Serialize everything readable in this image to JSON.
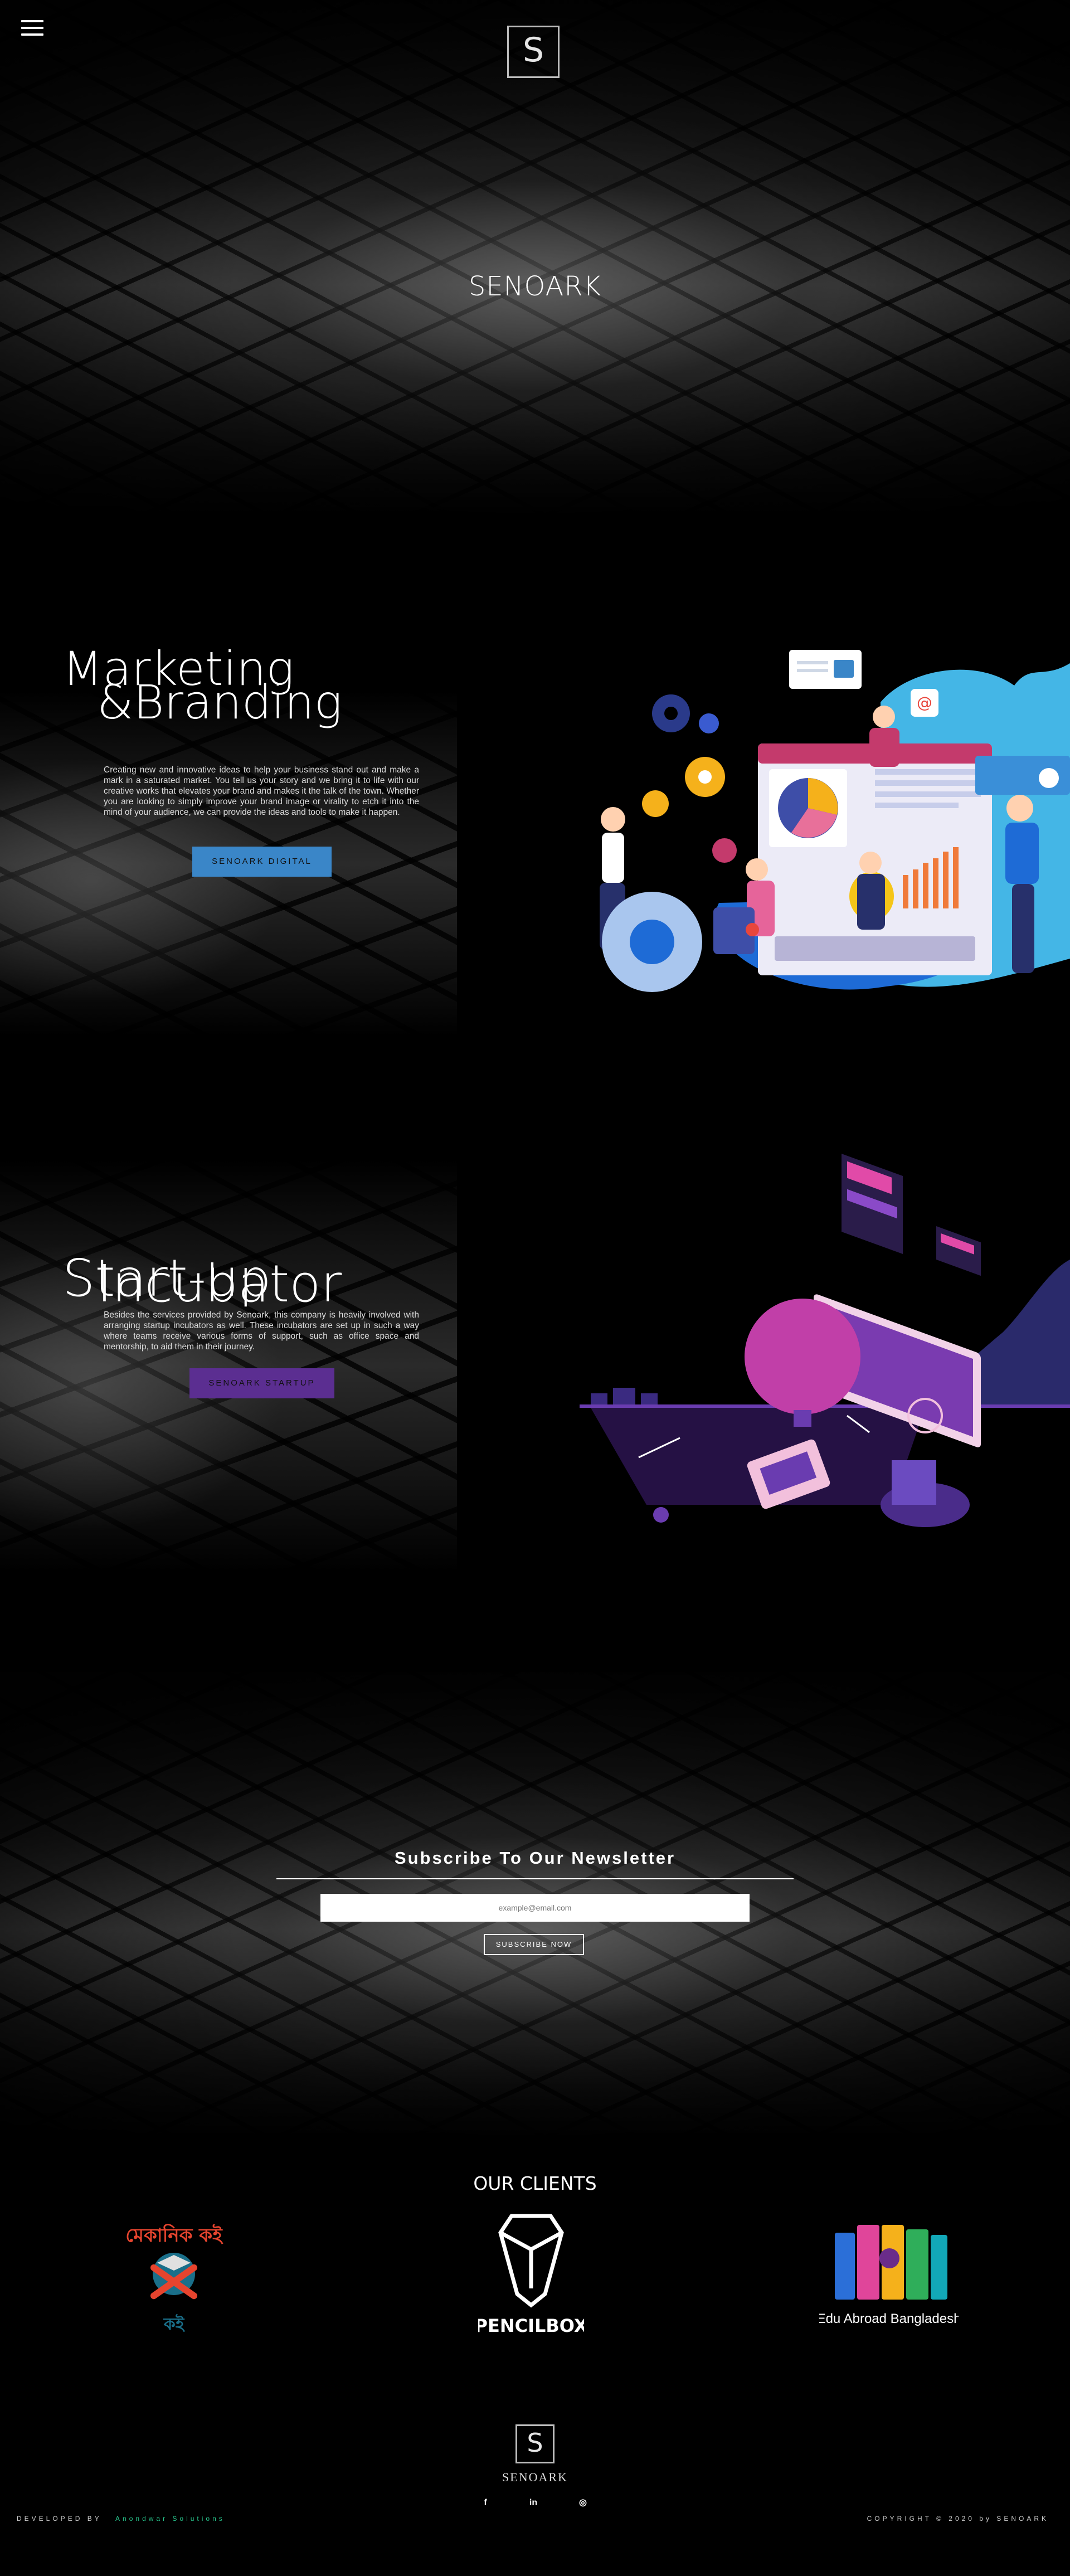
{
  "hero": {
    "menu_icon": "hamburger-icon",
    "logo_letter": "S",
    "title": "SENOARK"
  },
  "marketing": {
    "title_line1": "Marketing",
    "title_line2": "&Branding",
    "text": "Creating new and innovative ideas to help your business stand out and make a mark in a saturated market. You tell us your story and we bring it to life with our creative works that elevates your brand and makes it the talk of the town. Whether you are looking to simply improve your brand image or virality to etch it into the mind of your audience, we can provide the ideas and tools to make it happen.",
    "button_label": "SENOARK DIGITAL",
    "button_color": "#3a86c8"
  },
  "startup": {
    "title_line1": "Start-up",
    "title_line2": "Incubator",
    "text": "Besides the services provided by Senoark, this company is heavily involved with arranging startup incubators as well. These incubators are set up in such a way where teams receive various forms of support, such as office space and mentorship, to aid them in their journey.",
    "button_label": "SENOARK STARTUP",
    "button_color": "#5b2e91"
  },
  "newsletter": {
    "title": "Subscribe To Our Newsletter",
    "placeholder": "example@email.com",
    "button_label": "SUBSCRIBE NOW"
  },
  "clients": {
    "title": "OUR CLIENTS",
    "items": [
      {
        "name": "Mechanic Koi",
        "logo_text": "মেকানিক কই",
        "icon": "mechanic-logo"
      },
      {
        "name": "Pencilbox",
        "logo_text": "PENCILBOX",
        "icon": "pencilbox-logo"
      },
      {
        "name": "Edu Abroad Bangladesh",
        "logo_text": "Edu Abroad Bangladesh",
        "icon": "edu-abroad-logo"
      }
    ]
  },
  "footer": {
    "logo_letter": "S",
    "brand": "SENOARK",
    "social": [
      {
        "icon": "facebook-icon",
        "glyph": "f"
      },
      {
        "icon": "linkedin-icon",
        "glyph": "in"
      },
      {
        "icon": "instagram-icon",
        "glyph": "◎"
      }
    ],
    "developed_by_label": "DEVELOPED BY",
    "developer": "Anondwar Solutions",
    "copyright": "COPYRIGHT © 2020 by SENOARK"
  }
}
